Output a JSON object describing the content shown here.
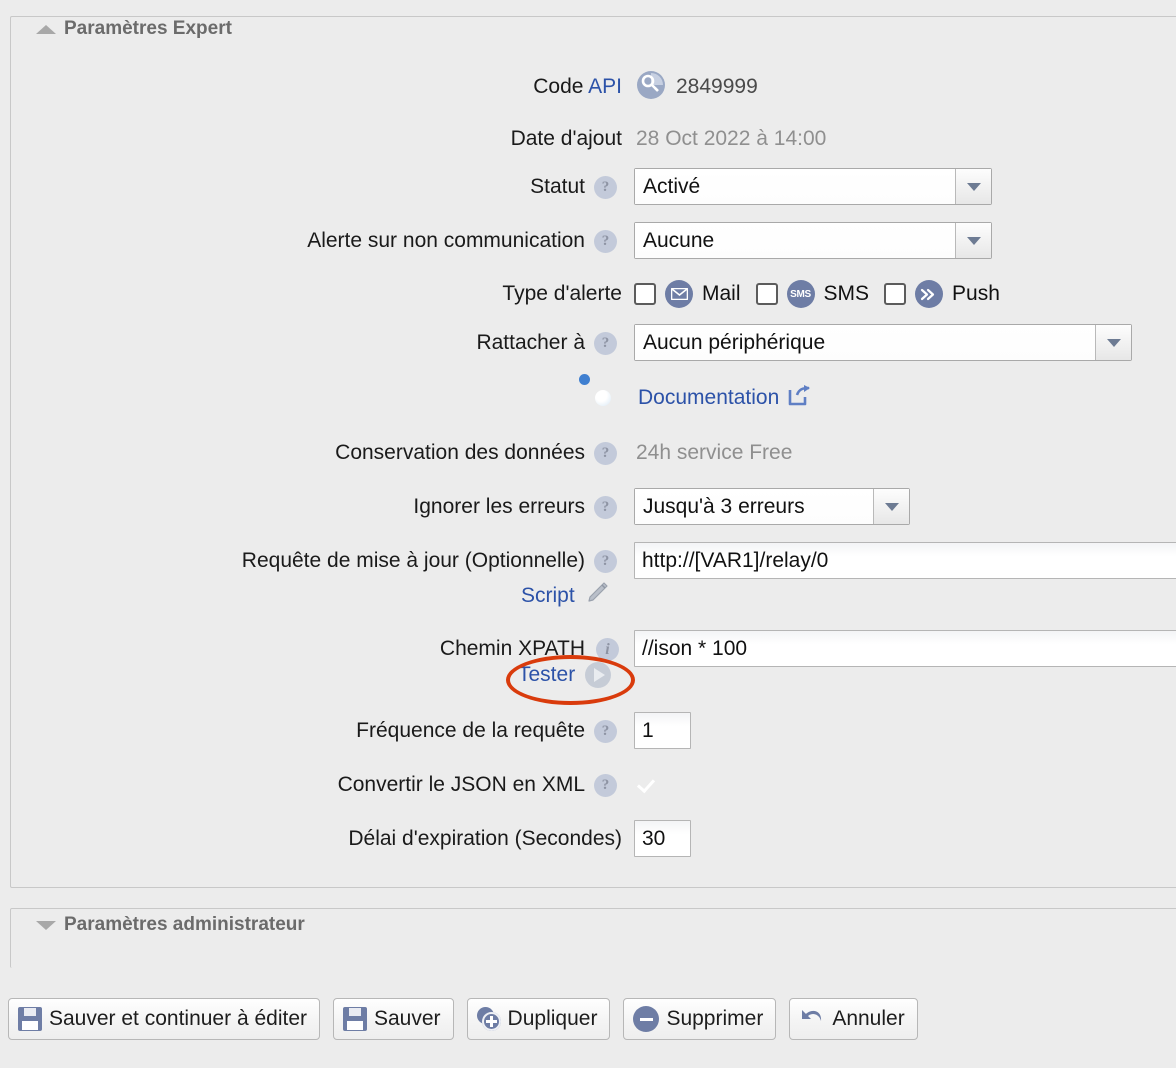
{
  "sections": {
    "expert": {
      "legend": "Paramètres Expert",
      "collapse_state": "expanded"
    },
    "admin": {
      "legend": "Paramètres administrateur",
      "collapse_state": "collapsed"
    }
  },
  "form": {
    "code_api": {
      "label_prefix": "Code ",
      "label_api": "API",
      "value": "2849999",
      "icon": "key-icon"
    },
    "date_ajout": {
      "label": "Date d'ajout",
      "value": "28 Oct 2022 à 14:00"
    },
    "statut": {
      "label": "Statut",
      "value": "Activé"
    },
    "alerte_non_comm": {
      "label": "Alerte sur non communication",
      "value": "Aucune"
    },
    "type_alerte": {
      "label": "Type d'alerte",
      "options": [
        {
          "name": "Mail",
          "icon": "mail-icon",
          "checked": false
        },
        {
          "name": "SMS",
          "icon": "sms-icon",
          "checked": false
        },
        {
          "name": "Push",
          "icon": "push-icon",
          "checked": false
        }
      ]
    },
    "rattacher": {
      "label": "Rattacher à",
      "value": "Aucun périphérique"
    },
    "documentation": {
      "label": "Documentation",
      "icon": "globe-icon",
      "link_icon": "external-link-icon"
    },
    "conservation": {
      "label": "Conservation des données",
      "value": "24h service Free"
    },
    "ignorer_erreurs": {
      "label": "Ignorer les erreurs",
      "value": "Jusqu'à 3 erreurs"
    },
    "requete_maj": {
      "label": "Requête de mise à jour (Optionnelle)",
      "value": "http://[VAR1]/relay/0"
    },
    "script": {
      "label": "Script",
      "icon": "pencil-icon"
    },
    "chemin_xpath": {
      "label": "Chemin XPATH",
      "value": "//ison * 100"
    },
    "tester": {
      "label": "Tester",
      "icon": "play-icon",
      "highlight_color": "#d93b0c"
    },
    "frequence": {
      "label": "Fréquence de la requête",
      "value": "1"
    },
    "convertir_json": {
      "label": "Convertir le JSON en XML",
      "checked": true
    },
    "delai_expiration": {
      "label": "Délai d'expiration (Secondes)",
      "value": "30"
    }
  },
  "buttons": [
    {
      "label": "Sauver et continuer à éditer",
      "icon": "save-icon"
    },
    {
      "label": "Sauver",
      "icon": "save-icon"
    },
    {
      "label": "Dupliquer",
      "icon": "duplicate-icon"
    },
    {
      "label": "Supprimer",
      "icon": "delete-icon"
    },
    {
      "label": "Annuler",
      "icon": "undo-icon"
    }
  ],
  "colors": {
    "background": "#ececec",
    "link": "#2c52a8",
    "accent_checkbox": "#3b7bf5",
    "icon_blue_grey": "#6e7da5",
    "highlight_red": "#d93b0c",
    "legend_text": "#6b6b6b"
  }
}
